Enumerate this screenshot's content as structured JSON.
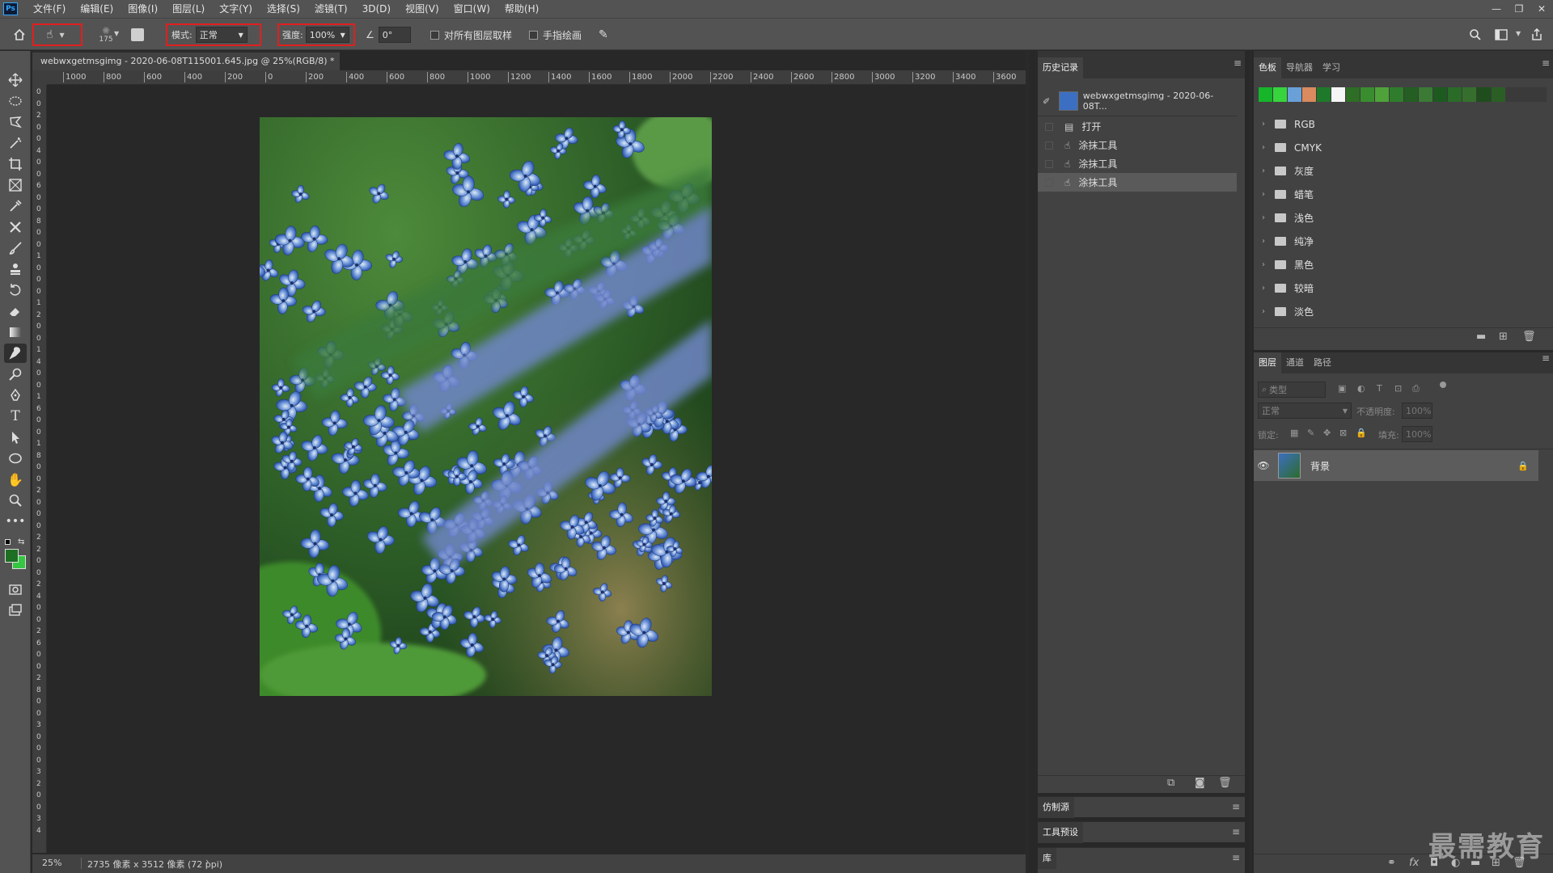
{
  "menubar": {
    "app_logo": "Ps",
    "items": [
      "文件(F)",
      "编辑(E)",
      "图像(I)",
      "图层(L)",
      "文字(Y)",
      "选择(S)",
      "滤镜(T)",
      "3D(D)",
      "视图(V)",
      "窗口(W)",
      "帮助(H)"
    ],
    "window_controls": [
      "—",
      "❐",
      "✕"
    ]
  },
  "options": {
    "brush_size": "175",
    "mode_label": "模式:",
    "mode_value": "正常",
    "strength_label": "强度:",
    "strength_value": "100%",
    "angle_value": "0°",
    "sample_all_layers": "对所有图层取样",
    "finger_painting": "手指绘画"
  },
  "document": {
    "tab_title": "webwxgetmsgimg - 2020-06-08T115001.645.jpg @ 25%(RGB/8) *",
    "tab_close": "×",
    "ruler_h_labels": [
      "1000",
      "800",
      "600",
      "400",
      "200",
      "0",
      "200",
      "400",
      "600",
      "800",
      "1000",
      "1200",
      "1400",
      "1600",
      "1800",
      "2000",
      "2200",
      "2400",
      "2600",
      "2800",
      "3000",
      "3200",
      "3400",
      "3600"
    ],
    "ruler_v_labels": [
      "0",
      "0",
      "2",
      "0",
      "0",
      "4",
      "0",
      "0",
      "6",
      "0",
      "0",
      "8",
      "0",
      "0",
      "1",
      "0",
      "0",
      "0",
      "1",
      "2",
      "0",
      "0",
      "1",
      "4",
      "0",
      "0",
      "1",
      "6",
      "0",
      "0",
      "1",
      "8",
      "0",
      "0",
      "2",
      "0",
      "0",
      "0",
      "2",
      "2",
      "0",
      "0",
      "2",
      "4",
      "0",
      "0",
      "2",
      "6",
      "0",
      "0",
      "2",
      "8",
      "0",
      "0",
      "3",
      "0",
      "0",
      "0",
      "3",
      "2",
      "0",
      "0",
      "3",
      "4"
    ],
    "zoom": "25%",
    "doc_info": "2735 像素 x 3512 像素 (72 ppi)"
  },
  "history": {
    "tab": "历史记录",
    "snapshot_name": "webwxgetmsgimg - 2020-06-08T...",
    "items": [
      "打开",
      "涂抹工具",
      "涂抹工具",
      "涂抹工具"
    ]
  },
  "swatches": {
    "tabs": [
      "色板",
      "导航器",
      "学习"
    ],
    "colors": [
      "#16b52a",
      "#37d43d",
      "#6aa0d8",
      "#d98a5f",
      "#1e7a2a",
      "#f5f5f5",
      "#2d6d25",
      "#3a8d2f",
      "#4fa23a",
      "#2f7d2c",
      "#245e22",
      "#3b7a35",
      "#1d5a1f",
      "#2a6b28",
      "#366f2d",
      "#1f4d1c",
      "#2a5e25"
    ],
    "groups": [
      "RGB",
      "CMYK",
      "灰度",
      "蜡笔",
      "浅色",
      "纯净",
      "黑色",
      "较暗",
      "淡色"
    ]
  },
  "layers": {
    "tabs": [
      "图层",
      "通道",
      "路径"
    ],
    "search_placeholder": "类型",
    "blend_mode": "正常",
    "opacity_label": "不透明度:",
    "opacity_value": "100%",
    "lock_label": "锁定:",
    "fill_label": "填充:",
    "fill_value": "100%",
    "layer_name": "背景"
  },
  "collapsed_panels": [
    "仿制源",
    "工具预设",
    "库"
  ],
  "watermark": "最需教育"
}
